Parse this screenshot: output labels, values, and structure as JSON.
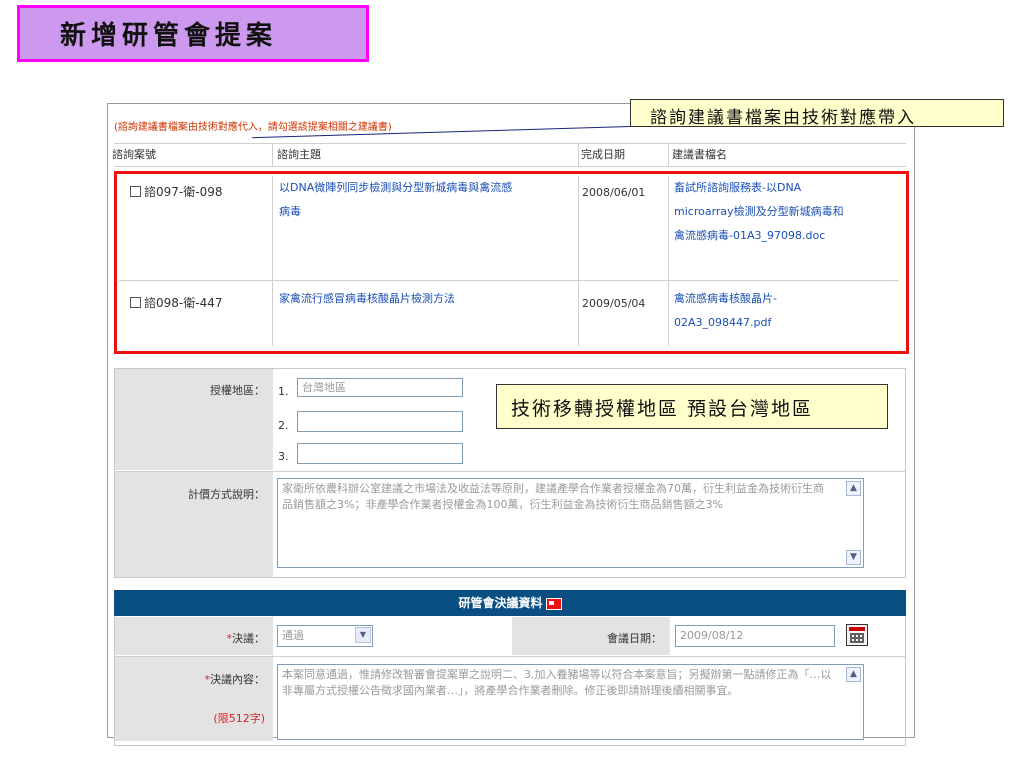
{
  "page_title": "新增研管會提案",
  "callouts": {
    "file_source": "諮詢建議書檔案由技術對應帶入",
    "region_default": "技術移轉授權地區  預設台灣地區"
  },
  "consult": {
    "note": "(諮詢建議書檔案由技術對應代入，請勾選該提案相關之建議書)",
    "headers": {
      "case_no": "諮詢案號",
      "topic": "諮詢主題",
      "done_date": "完成日期",
      "file_name": "建議書檔名"
    },
    "rows": [
      {
        "case_no": "諮097-衛-098",
        "topic": [
          "以DNA微陣列同步檢測與分型新城病毒與禽流感",
          "病毒"
        ],
        "done_date": "2008/06/01",
        "file_name": [
          "畜試所諮詢服務表-以DNA",
          "microarray檢測及分型新城病毒和",
          "禽流感病毒-01A3_97098.doc"
        ]
      },
      {
        "case_no": "諮098-衛-447",
        "topic": [
          "家禽流行感冒病毒核酸晶片檢測方法"
        ],
        "done_date": "2009/05/04",
        "file_name": [
          "禽流感病毒核酸晶片-",
          "02A3_098447.pdf"
        ]
      }
    ]
  },
  "license": {
    "region_label": "授權地區：",
    "regions": [
      {
        "num": "1.",
        "value": "台灣地區"
      },
      {
        "num": "2.",
        "value": ""
      },
      {
        "num": "3.",
        "value": ""
      }
    ],
    "pricing_label": "計價方式說明：",
    "pricing_text": "家衛所依農科辦公室建議之市場法及收益法等原則，建議產學合作業者授權金為70萬，衍生利益金為技術衍生商品銷售額之3%；非產學合作業者授權金為100萬，衍生利益金為技術衍生商品銷售額之3%"
  },
  "resolution": {
    "section_title": "研管會決議資料",
    "decision_label": "決議：",
    "decision_value": "通過",
    "meeting_date_label": "會議日期：",
    "meeting_date_value": "2009/08/12",
    "content_label": "決議內容：",
    "content_limit": "(限512字)",
    "content_text": "本案同意通過，惟請修改智審會提案單之說明二、3.加入養豬場等以符合本案意旨；另擬辦第一點請修正為「…以非專屬方式授權公告徵求國內業者…」，將產學合作業者刪除。修正後即請辦理後續相關事宜。",
    "required_mark": "*"
  },
  "colors": {
    "accent": "#0a4f82",
    "highlight": "#ee1111",
    "title_bg": "#cc99ee",
    "title_border": "#ff00ff",
    "callout_bg": "#ffffcc"
  }
}
